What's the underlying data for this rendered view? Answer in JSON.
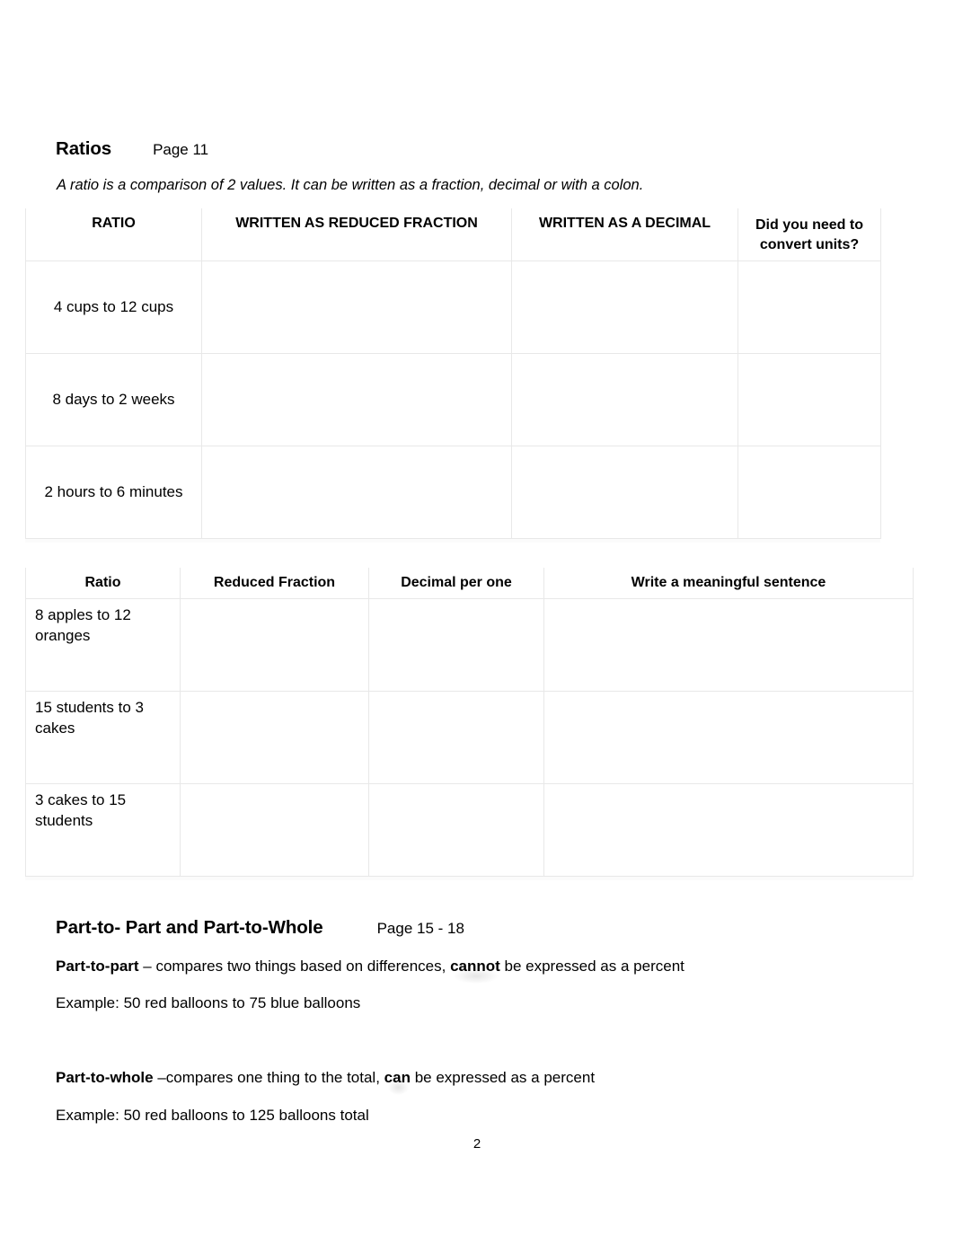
{
  "document": {
    "page_number": "2"
  },
  "sections": [
    {
      "id": "ratios",
      "title": "Ratios",
      "page_ref": "Page 11",
      "intro": "A ratio is a comparison of 2 values.  It can be written as a fraction, decimal or with a colon."
    },
    {
      "id": "part-to-part-whole",
      "title": "Part-to- Part and Part-to-Whole",
      "page_ref": "Page 15 - 18"
    }
  ],
  "table1": {
    "headers": [
      "RATIO",
      "WRITTEN AS REDUCED FRACTION",
      "WRITTEN AS A DECIMAL",
      "Did you need to convert units?"
    ],
    "rows": [
      {
        "ratio": "4 cups to 12 cups",
        "fraction": "",
        "decimal": "",
        "convert": ""
      },
      {
        "ratio": "8 days to 2 weeks",
        "fraction": "",
        "decimal": "",
        "convert": ""
      },
      {
        "ratio": "2 hours to 6 minutes",
        "fraction": "",
        "decimal": "",
        "convert": ""
      }
    ]
  },
  "table2": {
    "headers": [
      "Ratio",
      "Reduced Fraction",
      "Decimal per one",
      "Write a meaningful sentence"
    ],
    "rows": [
      {
        "ratio": "8 apples to 12 oranges",
        "fraction": "",
        "decimal": "",
        "sentence": ""
      },
      {
        "ratio": "15 students to 3 cakes",
        "fraction": "",
        "decimal": "",
        "sentence": ""
      },
      {
        "ratio": "3 cakes to 15 students",
        "fraction": "",
        "decimal": "",
        "sentence": ""
      }
    ]
  },
  "definitions": {
    "part_to_part": {
      "term": "Part-to-part",
      "text_before": " – compares two things based on differences, ",
      "emphasis": "cannot",
      "text_after": " be expressed as a percent",
      "example": "Example:  50 red balloons to 75 blue balloons"
    },
    "part_to_whole": {
      "term": "Part-to-whole",
      "text_before": " –compares one thing to the total, ",
      "emphasis": "can",
      "text_after": " be expressed as a percent",
      "example": "Example: 50 red balloons to 125 balloons total"
    }
  }
}
